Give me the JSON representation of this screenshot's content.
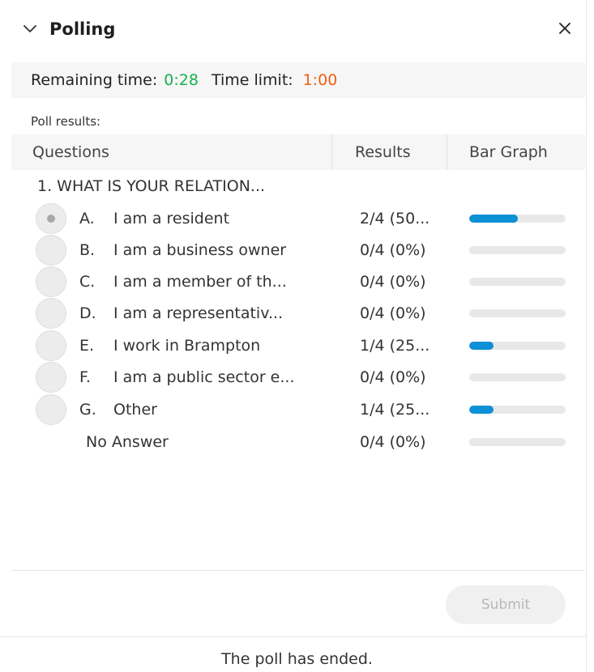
{
  "header": {
    "title": "Polling",
    "collapse_icon": "chevron-down-icon",
    "close_icon": "close-icon"
  },
  "timebar": {
    "remaining_label": "Remaining time:",
    "remaining_value": "0:28",
    "limit_label": "Time limit:",
    "limit_value": "1:00",
    "remaining_color": "#17b04f",
    "limit_color": "#f0600f"
  },
  "results_label": "Poll results:",
  "table": {
    "col_questions": "Questions",
    "col_results": "Results",
    "col_bar_graph": "Bar Graph"
  },
  "question": {
    "text": "1. WHAT IS YOUR RELATION..."
  },
  "options": [
    {
      "letter": "A.",
      "text": "I am a resident",
      "result": "2/4 (50...",
      "fraction": 0.5,
      "selected": true
    },
    {
      "letter": "B.",
      "text": "I am a business owner",
      "result": "0/4 (0%)",
      "fraction": 0,
      "selected": false
    },
    {
      "letter": "C.",
      "text": "I am a member of th...",
      "result": "0/4 (0%)",
      "fraction": 0,
      "selected": false
    },
    {
      "letter": "D.",
      "text": "I am a representativ...",
      "result": "0/4 (0%)",
      "fraction": 0,
      "selected": false
    },
    {
      "letter": "E.",
      "text": "I work in Brampton",
      "result": "1/4 (25...",
      "fraction": 0.25,
      "selected": false
    },
    {
      "letter": "F.",
      "text": "I am a public sector e...",
      "result": "0/4 (0%)",
      "fraction": 0,
      "selected": false
    },
    {
      "letter": "G.",
      "text": "Other",
      "result": "1/4 (25...",
      "fraction": 0.25,
      "selected": false
    }
  ],
  "no_answer": {
    "text": "No Answer",
    "result": "0/4 (0%)",
    "fraction": 0
  },
  "bar_color": "#0e90d6",
  "footer": {
    "submit_label": "Submit",
    "status_text": "The poll has ended."
  }
}
